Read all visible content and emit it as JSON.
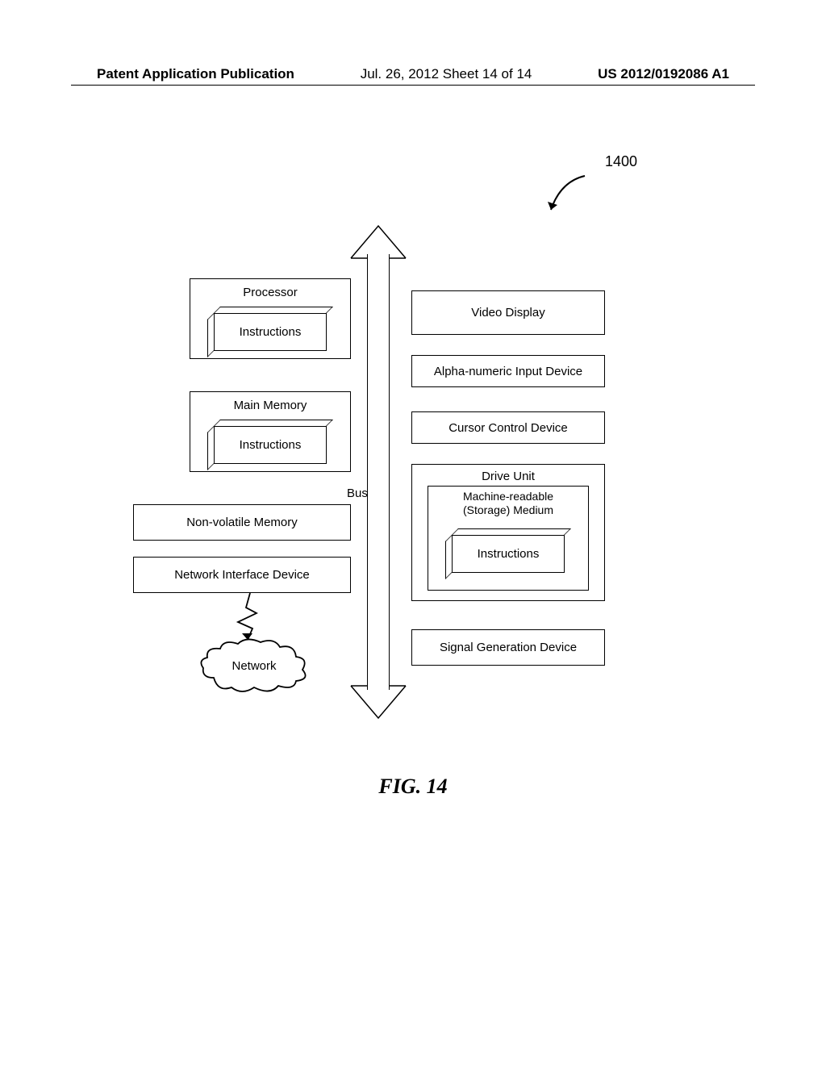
{
  "header": {
    "left": "Patent Application Publication",
    "mid": "Jul. 26, 2012  Sheet 14 of 14",
    "right": "US 2012/0192086 A1"
  },
  "ref": {
    "label": "1400"
  },
  "bus": {
    "label": "Bus"
  },
  "left_col": {
    "processor": {
      "title": "Processor",
      "inner": "Instructions"
    },
    "main_memory": {
      "title": "Main Memory",
      "inner": "Instructions"
    },
    "nvm": "Non-volatile Memory",
    "nid": "Network Interface Device"
  },
  "right_col": {
    "video": "Video Display",
    "alpha": "Alpha-numeric Input Device",
    "cursor": "Cursor Control Device",
    "drive": {
      "title": "Drive Unit",
      "medium_line1": "Machine-readable",
      "medium_line2": "(Storage) Medium",
      "inner": "Instructions"
    },
    "siggen": "Signal Generation Device"
  },
  "network": {
    "label": "Network"
  },
  "caption": "FIG. 14"
}
